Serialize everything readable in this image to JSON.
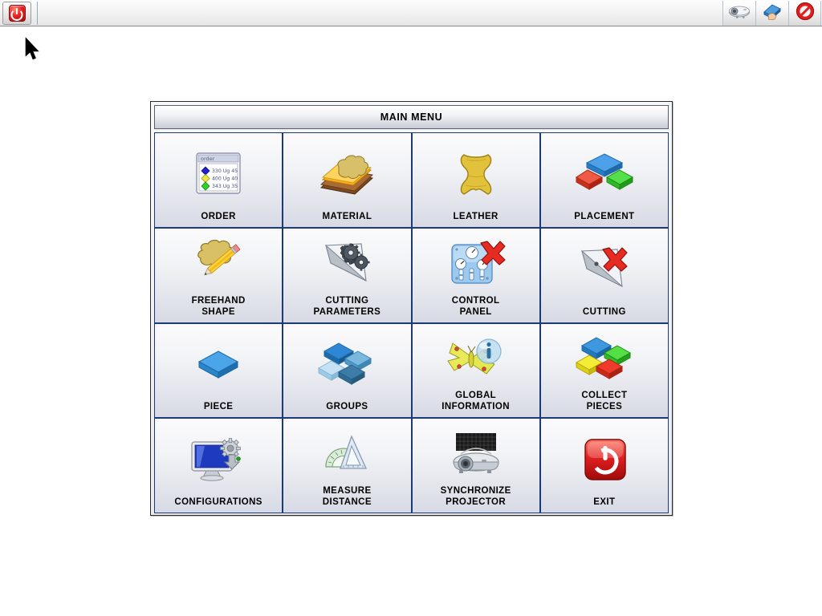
{
  "toolbar": {
    "power_button": {
      "name": "power",
      "label": "",
      "color": "#e52222"
    },
    "right_icons": [
      {
        "name": "projector-icon",
        "label": ""
      },
      {
        "name": "hand-eraser-icon",
        "label": ""
      },
      {
        "name": "prohibition-icon",
        "label": ""
      }
    ]
  },
  "panel": {
    "title": "MAIN MENU",
    "border_color": "#1b3a7a"
  },
  "order_window": {
    "title": "order",
    "rows": [
      {
        "color": "#2020d0",
        "text": "330 Ug 45"
      },
      {
        "color": "#e8e840",
        "text": "400 Ug 40"
      },
      {
        "color": "#30d030",
        "text": "343 Ug 35"
      }
    ]
  },
  "menu": {
    "items": [
      {
        "id": "order",
        "label": "ORDER",
        "icon": "order-window-icon"
      },
      {
        "id": "material",
        "label": "MATERIAL",
        "icon": "material-layers-icon"
      },
      {
        "id": "leather",
        "label": "LEATHER",
        "icon": "leather-hide-icon"
      },
      {
        "id": "placement",
        "label": "PLACEMENT",
        "icon": "placement-blocks-icon"
      },
      {
        "id": "freehand-shape",
        "label": "FREEHAND\nSHAPE",
        "icon": "hide-pencil-icon"
      },
      {
        "id": "cutting-parameters",
        "label": "CUTTING\nPARAMETERS",
        "icon": "blade-gears-icon"
      },
      {
        "id": "control-panel",
        "label": "CONTROL\nPANEL",
        "icon": "control-panel-x-icon"
      },
      {
        "id": "cutting",
        "label": "CUTTING",
        "icon": "blade-x-icon"
      },
      {
        "id": "piece",
        "label": "PIECE",
        "icon": "single-diamond-icon"
      },
      {
        "id": "groups",
        "label": "GROUPS",
        "icon": "blue-diamonds-icon"
      },
      {
        "id": "global-information",
        "label": "GLOBAL\nINFORMATION",
        "icon": "butterfly-info-icon"
      },
      {
        "id": "collect-pieces",
        "label": "COLLECT\nPIECES",
        "icon": "color-diamonds-icon"
      },
      {
        "id": "configurations",
        "label": "CONFIGURATIONS",
        "icon": "monitor-gear-icon"
      },
      {
        "id": "measure-distance",
        "label": "MEASURE\nDISTANCE",
        "icon": "protractor-ruler-icon"
      },
      {
        "id": "synchronize-projector",
        "label": "SYNCHRONIZE\nPROJECTOR",
        "icon": "projector-screen-icon"
      },
      {
        "id": "exit",
        "label": "EXIT",
        "icon": "red-power-icon"
      }
    ]
  }
}
